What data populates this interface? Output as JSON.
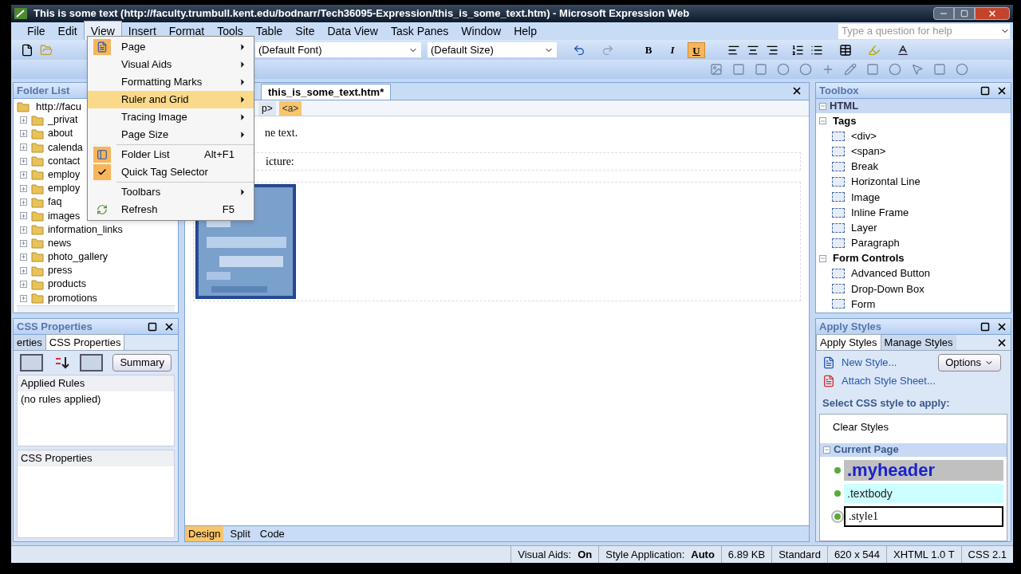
{
  "window": {
    "title": "This is some text (http://faculty.trumbull.kent.edu/bodnarr/Tech36095-Expression/this_is_some_text.htm) - Microsoft Expression Web"
  },
  "menu_bar": [
    {
      "label": "File",
      "selected": false
    },
    {
      "label": "Edit",
      "selected": false
    },
    {
      "label": "View",
      "selected": true
    },
    {
      "label": "Insert",
      "selected": false
    },
    {
      "label": "Format",
      "selected": false
    },
    {
      "label": "Tools",
      "selected": false
    },
    {
      "label": "Table",
      "selected": false
    },
    {
      "label": "Site",
      "selected": false
    },
    {
      "label": "Data View",
      "selected": false
    },
    {
      "label": "Task Panes",
      "selected": false
    },
    {
      "label": "Window",
      "selected": false
    },
    {
      "label": "Help",
      "selected": false
    }
  ],
  "help_search": {
    "placeholder": "Type a question for help"
  },
  "toolbar": {
    "font": "(Default Font)",
    "size": "(Default Size)",
    "format_buttons": [
      {
        "label": "B",
        "on": false
      },
      {
        "label": "I",
        "on": false
      },
      {
        "label": "U",
        "on": true
      }
    ]
  },
  "view_menu": [
    {
      "kind": "submenu",
      "label": "Page",
      "icon": true,
      "checked": false,
      "selected": false
    },
    {
      "kind": "submenu",
      "label": "Visual Aids",
      "icon": false,
      "checked": false,
      "selected": false
    },
    {
      "kind": "submenu",
      "label": "Formatting Marks",
      "icon": false,
      "checked": false,
      "selected": false
    },
    {
      "kind": "submenu",
      "label": "Ruler and Grid",
      "icon": false,
      "checked": false,
      "selected": true
    },
    {
      "kind": "submenu",
      "label": "Tracing Image",
      "icon": false,
      "checked": false,
      "selected": false
    },
    {
      "kind": "submenu",
      "label": "Page Size",
      "icon": false,
      "checked": false,
      "selected": false
    },
    {
      "kind": "command",
      "label": "Folder List",
      "shortcut": "Alt+F1",
      "icon": true,
      "checked": false,
      "selected": false
    },
    {
      "kind": "command",
      "label": "Quick Tag Selector",
      "checked": true,
      "selected": false
    },
    {
      "kind": "submenu",
      "label": "Toolbars",
      "icon": false,
      "checked": false,
      "selected": false
    },
    {
      "kind": "command",
      "label": "Refresh",
      "shortcut": "F5",
      "icon": true,
      "checked": false,
      "selected": false
    }
  ],
  "folder_list": {
    "title": "Folder List",
    "root": "http://facu",
    "items": [
      "_privat",
      "about",
      "calenda",
      "contact",
      "employ",
      "employ",
      "faq",
      "images",
      "information_links",
      "news",
      "photo_gallery",
      "press",
      "products",
      "promotions"
    ]
  },
  "css_properties": {
    "title": "CSS Properties",
    "tabs": [
      {
        "label": "erties",
        "selected": false
      },
      {
        "label": "CSS Properties",
        "selected": true
      }
    ],
    "summary_button": "Summary",
    "applied_rules": "Applied Rules",
    "no_rules": "(no rules applied)",
    "properties_header": "CSS Properties"
  },
  "editor": {
    "tab": "this_is_some_text.htm*",
    "tag_selector": [
      {
        "label": "p>",
        "selected": false
      },
      {
        "label": "<a>",
        "selected": true
      }
    ],
    "lines": [
      "ne text.",
      "icture:"
    ],
    "view_tabs": [
      {
        "label": "Design",
        "selected": true
      },
      {
        "label": "Split",
        "selected": false
      },
      {
        "label": "Code",
        "selected": false
      }
    ]
  },
  "toolbox": {
    "title": "Toolbox",
    "section": "HTML",
    "groups": [
      {
        "label": "Tags",
        "expanded": true,
        "items": [
          "<div>",
          "<span>",
          "Break",
          "Horizontal Line",
          "Image",
          "Inline Frame",
          "Layer",
          "Paragraph"
        ]
      },
      {
        "label": "Form Controls",
        "expanded": true,
        "items": [
          "Advanced Button",
          "Drop-Down Box",
          "Form"
        ]
      }
    ]
  },
  "apply_styles": {
    "title": "Apply Styles",
    "tabs": [
      {
        "label": "Apply Styles",
        "selected": true
      },
      {
        "label": "Manage Styles",
        "selected": false
      }
    ],
    "new_style": "New Style...",
    "options": "Options",
    "attach": "Attach Style Sheet...",
    "prompt": "Select CSS style to apply:",
    "clear": "Clear Styles",
    "group": "Current Page",
    "styles": [
      {
        "kind": "header",
        "label": ".myheader",
        "selected": false
      },
      {
        "kind": "body",
        "label": ".textbody",
        "selected": false
      },
      {
        "kind": "style1",
        "label": ".style1",
        "selected": true
      }
    ]
  },
  "status_bar": [
    {
      "label": "Visual Aids:",
      "value": "On"
    },
    {
      "label": "Style Application:",
      "value": "Auto"
    },
    {
      "label": "6.89 KB"
    },
    {
      "label": "Standard"
    },
    {
      "label": "620 x 544"
    },
    {
      "label": "XHTML 1.0 T"
    },
    {
      "label": "CSS 2.1"
    }
  ]
}
